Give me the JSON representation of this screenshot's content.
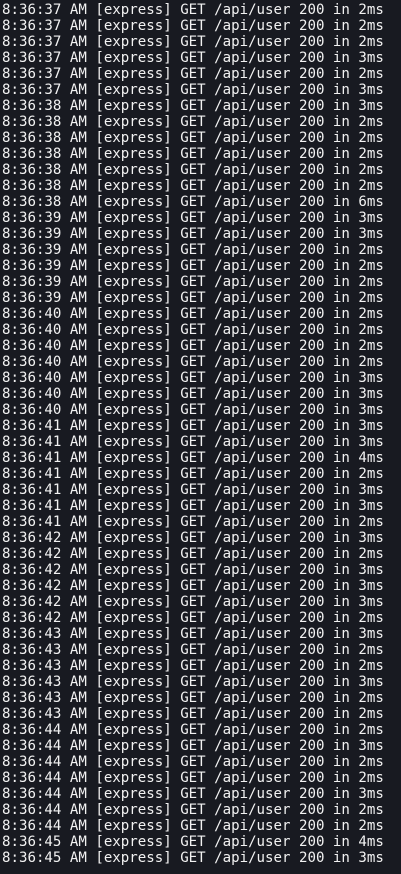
{
  "terminal": {
    "lines": [
      "8:36:37 AM [express] GET /api/user 200 in 2ms",
      "8:36:37 AM [express] GET /api/user 200 in 2ms",
      "8:36:37 AM [express] GET /api/user 200 in 2ms",
      "8:36:37 AM [express] GET /api/user 200 in 3ms",
      "8:36:37 AM [express] GET /api/user 200 in 2ms",
      "8:36:37 AM [express] GET /api/user 200 in 3ms",
      "8:36:38 AM [express] GET /api/user 200 in 3ms",
      "8:36:38 AM [express] GET /api/user 200 in 2ms",
      "8:36:38 AM [express] GET /api/user 200 in 2ms",
      "8:36:38 AM [express] GET /api/user 200 in 2ms",
      "8:36:38 AM [express] GET /api/user 200 in 2ms",
      "8:36:38 AM [express] GET /api/user 200 in 2ms",
      "8:36:38 AM [express] GET /api/user 200 in 6ms",
      "8:36:39 AM [express] GET /api/user 200 in 3ms",
      "8:36:39 AM [express] GET /api/user 200 in 3ms",
      "8:36:39 AM [express] GET /api/user 200 in 2ms",
      "8:36:39 AM [express] GET /api/user 200 in 2ms",
      "8:36:39 AM [express] GET /api/user 200 in 2ms",
      "8:36:39 AM [express] GET /api/user 200 in 2ms",
      "8:36:40 AM [express] GET /api/user 200 in 2ms",
      "8:36:40 AM [express] GET /api/user 200 in 2ms",
      "8:36:40 AM [express] GET /api/user 200 in 2ms",
      "8:36:40 AM [express] GET /api/user 200 in 2ms",
      "8:36:40 AM [express] GET /api/user 200 in 3ms",
      "8:36:40 AM [express] GET /api/user 200 in 3ms",
      "8:36:40 AM [express] GET /api/user 200 in 3ms",
      "8:36:41 AM [express] GET /api/user 200 in 3ms",
      "8:36:41 AM [express] GET /api/user 200 in 3ms",
      "8:36:41 AM [express] GET /api/user 200 in 4ms",
      "8:36:41 AM [express] GET /api/user 200 in 2ms",
      "8:36:41 AM [express] GET /api/user 200 in 3ms",
      "8:36:41 AM [express] GET /api/user 200 in 3ms",
      "8:36:41 AM [express] GET /api/user 200 in 2ms",
      "8:36:42 AM [express] GET /api/user 200 in 3ms",
      "8:36:42 AM [express] GET /api/user 200 in 2ms",
      "8:36:42 AM [express] GET /api/user 200 in 3ms",
      "8:36:42 AM [express] GET /api/user 200 in 3ms",
      "8:36:42 AM [express] GET /api/user 200 in 3ms",
      "8:36:42 AM [express] GET /api/user 200 in 2ms",
      "8:36:43 AM [express] GET /api/user 200 in 3ms",
      "8:36:43 AM [express] GET /api/user 200 in 2ms",
      "8:36:43 AM [express] GET /api/user 200 in 2ms",
      "8:36:43 AM [express] GET /api/user 200 in 3ms",
      "8:36:43 AM [express] GET /api/user 200 in 2ms",
      "8:36:43 AM [express] GET /api/user 200 in 2ms",
      "8:36:44 AM [express] GET /api/user 200 in 2ms",
      "8:36:44 AM [express] GET /api/user 200 in 3ms",
      "8:36:44 AM [express] GET /api/user 200 in 2ms",
      "8:36:44 AM [express] GET /api/user 200 in 2ms",
      "8:36:44 AM [express] GET /api/user 200 in 3ms",
      "8:36:44 AM [express] GET /api/user 200 in 2ms",
      "8:36:44 AM [express] GET /api/user 200 in 2ms",
      "8:36:45 AM [express] GET /api/user 200 in 4ms",
      "8:36:45 AM [express] GET /api/user 200 in 3ms"
    ]
  }
}
